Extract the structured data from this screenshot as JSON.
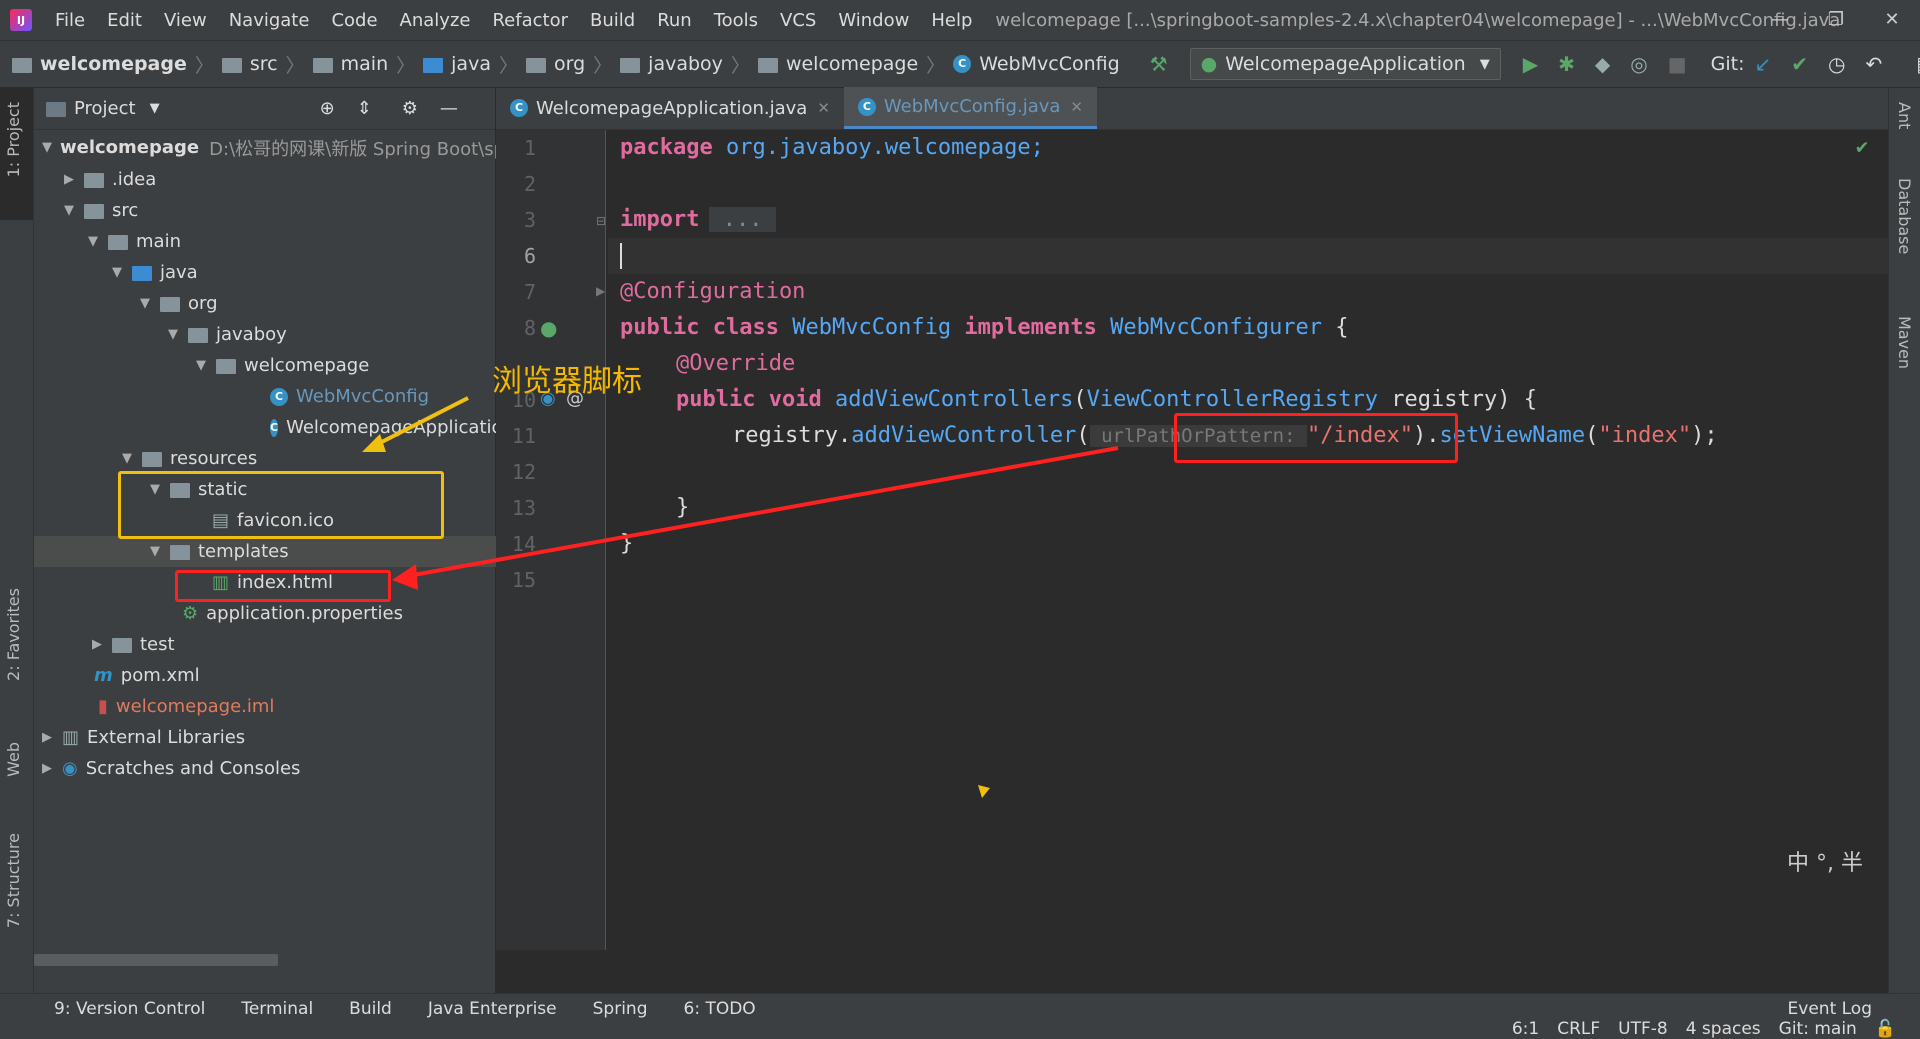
{
  "app": {
    "menus": [
      "File",
      "Edit",
      "View",
      "Navigate",
      "Code",
      "Analyze",
      "Refactor",
      "Build",
      "Run",
      "Tools",
      "VCS",
      "Window",
      "Help"
    ],
    "window_title": "welcomepage [...\\springboot-samples-2.4.x\\chapter04\\welcomepage] - ...\\WebMvcConfig.java",
    "window_controls": [
      "—",
      "❐",
      "✕"
    ]
  },
  "breadcrumb": [
    "welcomepage",
    "src",
    "main",
    "java",
    "org",
    "javaboy",
    "welcomepage",
    "WebMvcConfig"
  ],
  "run_config": "WelcomepageApplication",
  "git_label": "Git:",
  "left_tabs": {
    "project": "1: Project",
    "favorites": "2: Favorites",
    "web": "Web",
    "structure": "7: Structure"
  },
  "right_tabs": {
    "ant": "Ant",
    "database": "Database",
    "maven": "Maven"
  },
  "project": {
    "header": "Project",
    "root_name": "welcomepage",
    "root_path": "D:\\松哥的网课\\新版 Spring Boot\\sp",
    "items": {
      "idea": ".idea",
      "src": "src",
      "main": "main",
      "java": "java",
      "org": "org",
      "javaboy": "javaboy",
      "welcomepage": "welcomepage",
      "webmvcconfig": "WebMvcConfig",
      "app": "WelcomepageApplicatio",
      "resources": "resources",
      "static": "static",
      "favicon": "favicon.ico",
      "templates": "templates",
      "index": "index.html",
      "props": "application.properties",
      "test": "test",
      "pom": "pom.xml",
      "iml": "welcomepage.iml",
      "extlibs": "External Libraries",
      "scratches": "Scratches and Consoles"
    }
  },
  "editor_tabs": [
    {
      "label": "WelcomepageApplication.java"
    },
    {
      "label": "WebMvcConfig.java"
    }
  ],
  "code": {
    "line_numbers": [
      "1",
      "2",
      "3",
      "6",
      "7",
      "8",
      "10",
      "11",
      "12",
      "13",
      "14",
      "15"
    ],
    "l1_kw": "package",
    "l1_rest": " org.javaboy.welcomepage;",
    "l3_kw": "import",
    "l3_fold": " ... ",
    "l7_ann": "@Configuration",
    "l8_kw1": "public",
    "l8_kw2": "class",
    "l8_name": "WebMvcConfig",
    "l8_kw3": "implements",
    "l8_iface": "WebMvcConfigurer",
    "l8_brace": " {",
    "l9_ann": "@Override",
    "l10_kw1": "public",
    "l10_kw2": "void",
    "l10_fn": "addViewControllers",
    "l10_p1": "(",
    "l10_type": "ViewControllerRegistry",
    "l10_p2": " registry) {",
    "l11_a": "registry.",
    "l11_fn": "addViewController",
    "l11_p": "(",
    "l11_hint": " urlPathOrPattern: ",
    "l11_str": "\"/index\"",
    "l11_p2": ")",
    "l11_dot": ".",
    "l11_fn2": "setViewName",
    "l11_p3": "(",
    "l11_str2": "\"index\"",
    "l11_end": ");",
    "l13": "}",
    "l14": "}"
  },
  "annotation": "浏览器脚标",
  "ime_indicator": "中 °, 半",
  "bottom_tabs": [
    "9: Version Control",
    "Terminal",
    "Build",
    "Java Enterprise",
    "Spring",
    "6: TODO",
    "Event Log"
  ],
  "status": {
    "position": "6:1",
    "line_sep": "CRLF",
    "encoding": "UTF-8",
    "indent": "4 spaces",
    "git": "Git: main"
  },
  "colors": {
    "annotation_red": "#ff2020",
    "annotation_yellow": "#f0c010",
    "accent": "#4a88c7"
  }
}
